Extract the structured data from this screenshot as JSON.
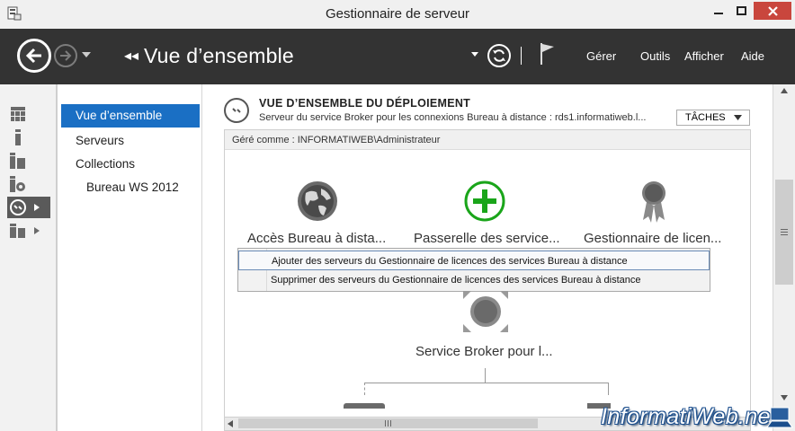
{
  "window": {
    "title": "Gestionnaire de serveur",
    "controls": {
      "minimize": "minimize-icon",
      "maximize": "maximize-icon",
      "close": "close-icon"
    }
  },
  "toolbar": {
    "breadcrumb_arrows": "◂◂",
    "page_title": "Vue d’ensemble",
    "menu": [
      "Gérer",
      "Outils",
      "Afficher",
      "Aide"
    ]
  },
  "sidebar": {
    "icons": [
      "dashboard-icon",
      "local-server-icon",
      "all-servers-icon",
      "file-storage-icon",
      "remote-desktop-icon",
      "roles-icon"
    ]
  },
  "nav": {
    "items": [
      {
        "label": "Vue d’ensemble",
        "active": true
      },
      {
        "label": "Serveurs"
      },
      {
        "label": "Collections"
      },
      {
        "label": "Bureau WS 2012"
      }
    ]
  },
  "deployment": {
    "title": "VUE D’ENSEMBLE DU DÉPLOIEMENT",
    "subtitle": "Serveur du service Broker pour les connexions Bureau à distance : rds1.informatiweb.l...",
    "tasks_label": "TÂCHES",
    "managed_as": "Géré comme : INFORMATIWEB\\Administrateur",
    "nodes": [
      {
        "label": "Accès Bureau à dista..."
      },
      {
        "label": "Passerelle des service..."
      },
      {
        "label": "Gestionnaire de licen..."
      },
      {
        "label": "Service Broker pour l..."
      }
    ],
    "context_menu": [
      "Ajouter des serveurs du Gestionnaire de licences des services Bureau à distance",
      "Supprimer des serveurs du Gestionnaire de licences des services Bureau à distance"
    ]
  },
  "watermark": "InformatiWeb.net",
  "colors": {
    "toolbar_bg": "#333333",
    "accent": "#1a6fc4",
    "gateway_green": "#1aa51a",
    "close_red": "#c9463d"
  }
}
